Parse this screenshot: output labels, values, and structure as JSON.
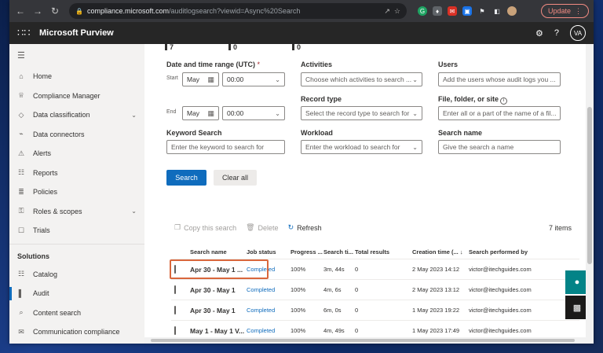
{
  "browser": {
    "url_domain": "compliance.microsoft.com",
    "url_path": "/auditlogsearch?viewid=Async%20Search",
    "update_label": "Update"
  },
  "app": {
    "title": "Microsoft Purview",
    "avatar": "VA"
  },
  "sidebar": {
    "items": [
      {
        "label": "Home",
        "icon": "home-icon"
      },
      {
        "label": "Compliance Manager",
        "icon": "trophy-icon"
      },
      {
        "label": "Data classification",
        "icon": "tag-icon",
        "expand": true
      },
      {
        "label": "Data connectors",
        "icon": "plug-icon"
      },
      {
        "label": "Alerts",
        "icon": "alert-icon"
      },
      {
        "label": "Reports",
        "icon": "chart-icon"
      },
      {
        "label": "Policies",
        "icon": "sliders-icon"
      },
      {
        "label": "Roles & scopes",
        "icon": "key-icon",
        "expand": true
      },
      {
        "label": "Trials",
        "icon": "clipboard-icon"
      }
    ],
    "section_label": "Solutions",
    "solutions": [
      {
        "label": "Catalog",
        "icon": "catalog-icon"
      },
      {
        "label": "Audit",
        "icon": "audit-icon",
        "active": true
      },
      {
        "label": "Content search",
        "icon": "search-icon"
      },
      {
        "label": "Communication compliance",
        "icon": "chat-icon"
      }
    ]
  },
  "counts": [
    "7",
    "0",
    "0"
  ],
  "form": {
    "date_label": "Date and time range (UTC)",
    "required_mark": "*",
    "start_label": "Start",
    "end_label": "End",
    "start_date": "May",
    "start_time": "00:00",
    "end_date": "May",
    "end_time": "00:00",
    "activities_label": "Activities",
    "activities_placeholder": "Choose which activities to search ...",
    "users_label": "Users",
    "users_placeholder": "Add the users whose audit logs you ...",
    "record_type_label": "Record type",
    "record_type_placeholder": "Select the record type to search for",
    "file_label": "File, folder, or site",
    "file_placeholder": "Enter all or a part of the name of a fil...",
    "keyword_label": "Keyword Search",
    "keyword_placeholder": "Enter the keyword to search for",
    "workload_label": "Workload",
    "workload_placeholder": "Enter the workload to search for",
    "search_name_label": "Search name",
    "search_name_placeholder": "Give the search a name",
    "search_button": "Search",
    "clear_button": "Clear all"
  },
  "commands": {
    "copy": "Copy this search",
    "delete": "Delete",
    "refresh": "Refresh",
    "item_count": "7 items"
  },
  "table": {
    "headers": [
      "Search name",
      "Job status",
      "Progress ...",
      "Search ti...",
      "Total results",
      "Creation time (...",
      "Search performed by"
    ],
    "rows": [
      {
        "name": "Apr 30 - May 1 ...",
        "status": "Completed",
        "progress": "100%",
        "time": "3m, 44s",
        "results": "0",
        "created": "2 May 2023 14:12",
        "by": "victor@itechguides.com"
      },
      {
        "name": "Apr 30 - May 1",
        "status": "Completed",
        "progress": "100%",
        "time": "4m, 6s",
        "results": "0",
        "created": "2 May 2023 13:12",
        "by": "victor@itechguides.com"
      },
      {
        "name": "Apr 30 - May 1",
        "status": "Completed",
        "progress": "100%",
        "time": "6m, 0s",
        "results": "0",
        "created": "1 May 2023 19:22",
        "by": "victor@itechguides.com"
      },
      {
        "name": "May 1 - May 1 V...",
        "status": "Completed",
        "progress": "100%",
        "time": "4m, 49s",
        "results": "0",
        "created": "1 May 2023 17:49",
        "by": "victor@itechguides.com"
      }
    ]
  }
}
